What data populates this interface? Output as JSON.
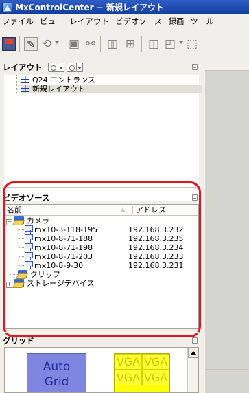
{
  "window": {
    "title": "MxControlCenter − 新規レイアウト"
  },
  "menubar": {
    "items": [
      "ファイル",
      "ビュー",
      "レイアウト",
      "ビデオソース",
      "録画",
      "ツール"
    ]
  },
  "toolbar": {
    "icons": [
      "save-icon",
      "edit-layout-icon",
      "refresh-icon",
      "camera-view-icon",
      "link-icon",
      "split-icon",
      "grid-icon",
      "window-icon",
      "window-add-icon",
      "more-icon"
    ]
  },
  "layout_panel": {
    "title": "レイアウト",
    "items": [
      {
        "label": "Q24 エントランス",
        "selected": false
      },
      {
        "label": "新規レイアウト",
        "selected": true
      }
    ]
  },
  "video_source_panel": {
    "title": "ビデオソース",
    "columns": [
      "名前",
      "アドレス"
    ],
    "groups": [
      {
        "label": "カメラ",
        "expanded": true,
        "cameras": [
          {
            "name": "mx10-3-118-195",
            "address": "192.168.3.232"
          },
          {
            "name": "mx10-8-71-188",
            "address": "192.168.3.235"
          },
          {
            "name": "mx10-8-71-198",
            "address": "192.168.3.234"
          },
          {
            "name": "mx10-8-71-203",
            "address": "192.168.3.233"
          },
          {
            "name": "mx10-8-9-30",
            "address": "192.168.3.231"
          }
        ]
      },
      {
        "label": "クリップ",
        "expanded": false
      },
      {
        "label": "ストレージデバイス",
        "expanded": false
      }
    ],
    "highlight_color": "#e4141e"
  },
  "grid_panel": {
    "title": "グリッド",
    "auto_grid": {
      "line1": "Auto",
      "line2": "Grid"
    },
    "vga_label": "VGA"
  }
}
